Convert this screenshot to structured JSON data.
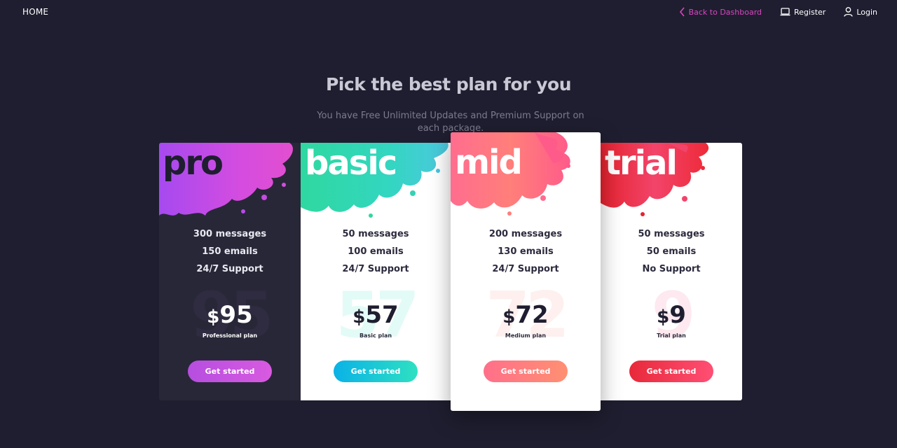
{
  "nav": {
    "home": "HOME",
    "back": "Back to Dashboard",
    "register": "Register",
    "login": "Login",
    "accent_color": "#d945c0"
  },
  "header": {
    "title": "Pick the best plan for you",
    "subtitle": "You have Free Unlimited Updates and Premium Support on each package."
  },
  "plans": [
    {
      "name": "pro",
      "features": [
        "300 messages",
        "150 emails",
        "24/7 Support"
      ],
      "currency": "$",
      "price": "95",
      "caption": "Professional plan",
      "cta": "Get started",
      "accent_colors": [
        "#b64ee0",
        "#d85ae0"
      ]
    },
    {
      "name": "basic",
      "features": [
        "50 messages",
        "100 emails",
        "24/7 Support"
      ],
      "currency": "$",
      "price": "57",
      "caption": "Basic plan",
      "cta": "Get started",
      "accent_colors": [
        "#0ab2e6",
        "#2ee0c2"
      ]
    },
    {
      "name": "mid",
      "features": [
        "200 messages",
        "130 emails",
        "24/7 Support"
      ],
      "currency": "$",
      "price": "72",
      "caption": "Medium plan",
      "cta": "Get started",
      "accent_colors": [
        "#ff6f89",
        "#ff9072"
      ]
    },
    {
      "name": "trial",
      "features": [
        "50 messages",
        "50 emails",
        "No Support"
      ],
      "currency": "$",
      "price": "9",
      "caption": "Trial plan",
      "cta": "Get started",
      "accent_colors": [
        "#e8293a",
        "#ff4f74"
      ]
    }
  ]
}
